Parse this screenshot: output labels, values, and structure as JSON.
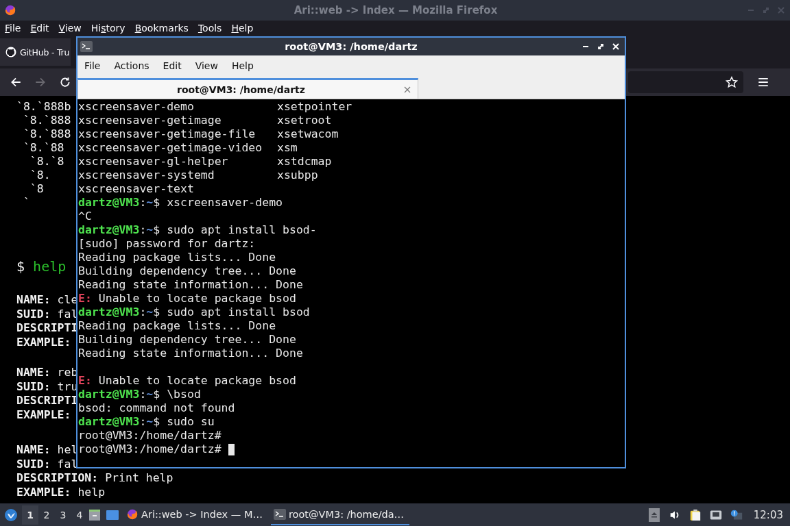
{
  "firefox": {
    "title": "Ari::web -> Index — Mozilla Firefox",
    "menu": [
      {
        "key": "F",
        "after": "ile"
      },
      {
        "key": "E",
        "after": "dit"
      },
      {
        "key": "V",
        "after": "iew"
      },
      {
        "before": "Hi",
        "key": "s",
        "after": "tory"
      },
      {
        "key": "B",
        "after": "ookmarks"
      },
      {
        "key": "T",
        "after": "ools"
      },
      {
        "key": "H",
        "after": "elp"
      }
    ],
    "tab": {
      "label": "GitHub - Tru"
    },
    "forward_disabled": true
  },
  "page": {
    "art": [
      "`8.`888b",
      " `8.`888",
      " `8.`888",
      " `8.`88",
      "  `8.`8",
      "  `8.",
      "  `8",
      " `"
    ],
    "prompt": {
      "sign": "$",
      "command": "help"
    },
    "entries": [
      [
        {
          "key": "NAME:",
          "value": "cle"
        },
        {
          "key": "SUID:",
          "value": "fal"
        },
        {
          "key": "DESCRIPTI"
        },
        {
          "key": "EXAMPLE:"
        }
      ],
      [
        {
          "key": "NAME:",
          "value": "reb"
        },
        {
          "key": "SUID:",
          "value": "tru"
        },
        {
          "key": "DESCRIPTI"
        },
        {
          "key": "EXAMPLE:"
        }
      ],
      [
        {
          "key": "NAME:",
          "value": "hel"
        },
        {
          "key": "SUID:",
          "value": "fal"
        },
        {
          "key": "DESCRIPTION:",
          "value": "Print help"
        },
        {
          "key": "EXAMPLE:",
          "value": "help"
        }
      ]
    ]
  },
  "terminal": {
    "title": "root@VM3: /home/dartz",
    "menu": [
      "File",
      "Actions",
      "Edit",
      "View",
      "Help"
    ],
    "tabs": [
      {
        "label": "root@VM3: /home/dartz",
        "selected": true
      }
    ],
    "lines": [
      {
        "kind": "columns",
        "cells": [
          "xscreensaver-demo",
          "xsetpointer"
        ]
      },
      {
        "kind": "columns",
        "cells": [
          "xscreensaver-getimage",
          "xsetroot"
        ]
      },
      {
        "kind": "columns",
        "cells": [
          "xscreensaver-getimage-file",
          "xsetwacom"
        ]
      },
      {
        "kind": "columns",
        "cells": [
          "xscreensaver-getimage-video",
          "xsm"
        ]
      },
      {
        "kind": "columns",
        "cells": [
          "xscreensaver-gl-helper",
          "xstdcmap"
        ]
      },
      {
        "kind": "columns",
        "cells": [
          "xscreensaver-systemd",
          "xsubpp"
        ]
      },
      {
        "kind": "text",
        "text": "xscreensaver-text"
      },
      {
        "kind": "prompt",
        "user": "dartz@VM3",
        "sep": ":",
        "path": "~",
        "rest": "$ xscreensaver-demo"
      },
      {
        "kind": "text",
        "text": "^C"
      },
      {
        "kind": "prompt",
        "user": "dartz@VM3",
        "sep": ":",
        "path": "~",
        "rest": "$ sudo apt install bsod-"
      },
      {
        "kind": "text",
        "text": "[sudo] password for dartz:"
      },
      {
        "kind": "text",
        "text": "Reading package lists... Done"
      },
      {
        "kind": "text",
        "text": "Building dependency tree... Done"
      },
      {
        "kind": "text",
        "text": "Reading state information... Done"
      },
      {
        "kind": "error",
        "tag": "E:",
        "text": "Unable to locate package bsod"
      },
      {
        "kind": "prompt",
        "user": "dartz@VM3",
        "sep": ":",
        "path": "~",
        "rest": "$ sudo apt install bsod"
      },
      {
        "kind": "text",
        "text": "Reading package lists... Done"
      },
      {
        "kind": "text",
        "text": "Building dependency tree... Done"
      },
      {
        "kind": "text",
        "text": "Reading state information... Done"
      },
      {
        "kind": "blank"
      },
      {
        "kind": "error",
        "tag": "E:",
        "text": "Unable to locate package bsod"
      },
      {
        "kind": "prompt",
        "user": "dartz@VM3",
        "sep": ":",
        "path": "~",
        "rest": "$ \\bsod"
      },
      {
        "kind": "text",
        "text": "bsod: command not found"
      },
      {
        "kind": "prompt",
        "user": "dartz@VM3",
        "sep": ":",
        "path": "~",
        "rest": "$ sudo su"
      },
      {
        "kind": "text",
        "text": "root@VM3:/home/dartz#"
      },
      {
        "kind": "text",
        "text": "root@VM3:/home/dartz#",
        "cursor": true
      }
    ]
  },
  "taskbar": {
    "workspaces": [
      {
        "label": "1",
        "selected": true
      },
      {
        "label": "2",
        "selected": false
      },
      {
        "label": "3",
        "selected": false
      },
      {
        "label": "4",
        "selected": false
      }
    ],
    "tasks": [
      {
        "kind": "firefox",
        "label": "Ari::web -> Index — M…",
        "selected": false
      },
      {
        "kind": "terminal",
        "label": "root@VM3: /home/da…",
        "selected": true
      }
    ],
    "clock": "12:03"
  }
}
